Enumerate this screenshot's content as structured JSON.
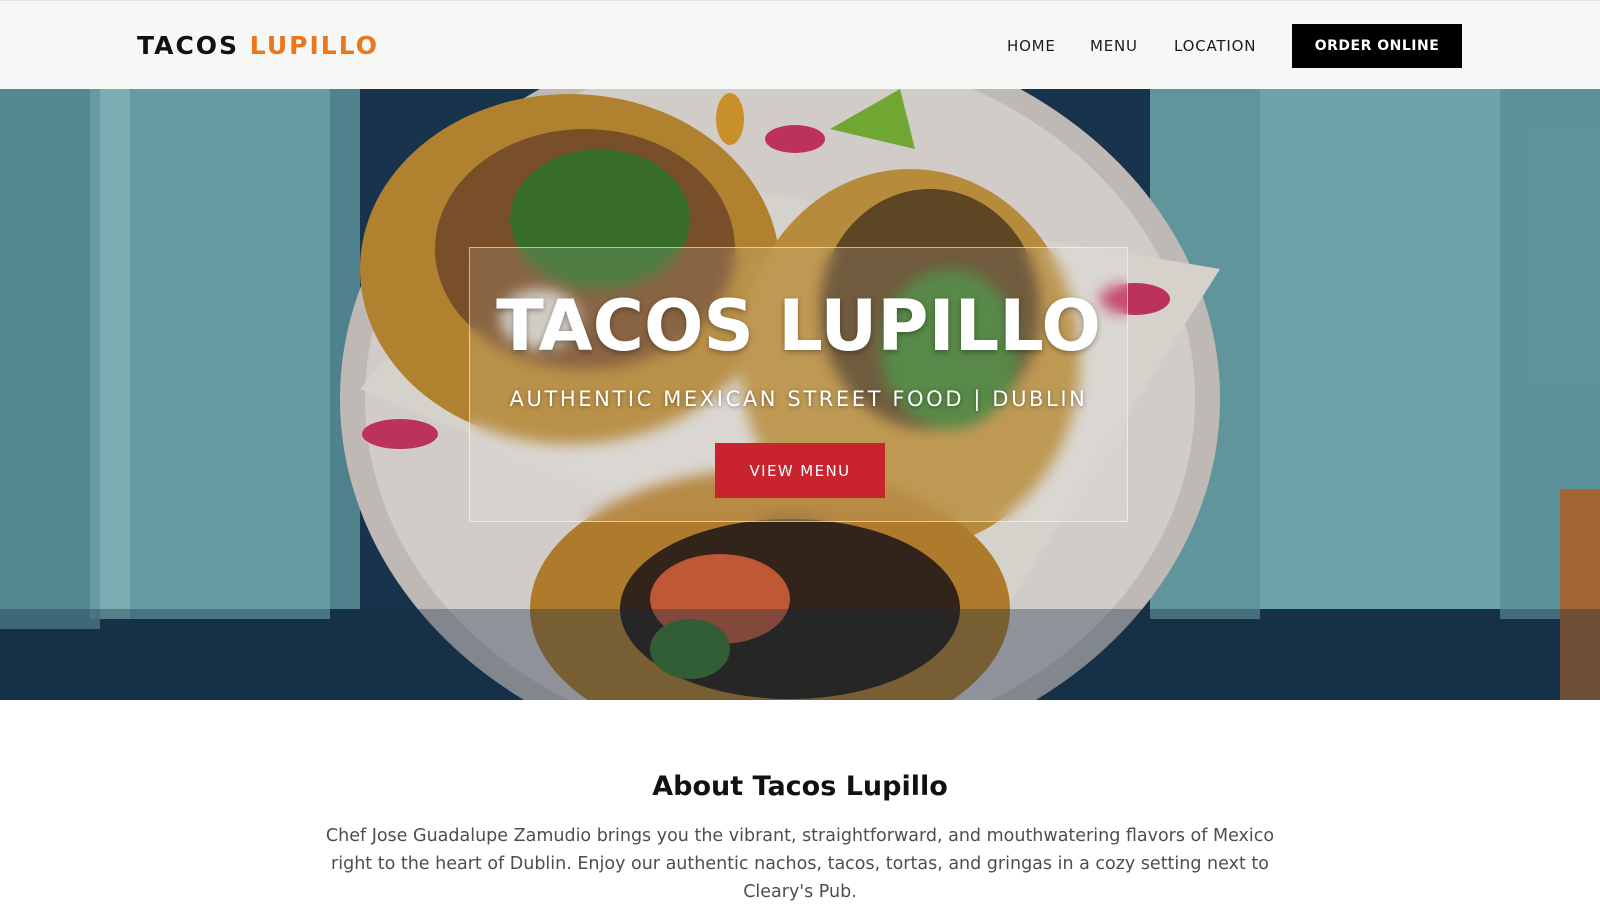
{
  "header": {
    "logo_part1": "TACOS",
    "logo_part2": "LUPILLO",
    "nav": {
      "home": "HOME",
      "menu": "MENU",
      "location": "LOCATION"
    },
    "order_button": "ORDER ONLINE"
  },
  "hero": {
    "title": "TACOS LUPILLO",
    "subtitle": "AUTHENTIC MEXICAN STREET FOOD | DUBLIN",
    "cta_button": "VIEW MENU",
    "background_image": "tacos-on-plate-photo"
  },
  "about": {
    "title": "About Tacos Lupillo",
    "text": "Chef Jose Guadalupe Zamudio brings you the vibrant, straightforward, and mouthwatering flavors of Mexico right to the heart of Dublin. Enjoy our authentic nachos, tacos, tortas, and gringas in a cozy setting next to Cleary's Pub."
  },
  "colors": {
    "accent_orange": "#e8771d",
    "cta_red": "#c8232f",
    "order_black": "#000000",
    "header_bg": "#f7f7f6"
  }
}
